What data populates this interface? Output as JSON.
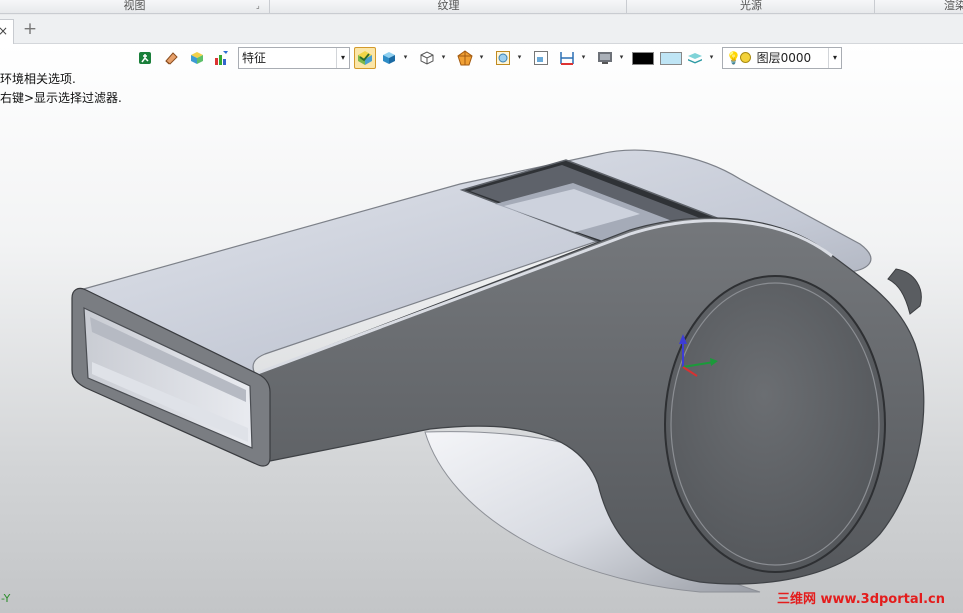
{
  "ribbon": {
    "groups": [
      {
        "label": "视图"
      },
      {
        "label": "纹理"
      },
      {
        "label": "光源"
      },
      {
        "label": "渲染"
      }
    ]
  },
  "tabs": {
    "close_glyph": "×",
    "add_glyph": "+"
  },
  "toolbar": {
    "icons": [
      {
        "name": "exit-icon",
        "color": "#1a7f3a"
      },
      {
        "name": "eraser-icon",
        "color": "#d98b4f"
      },
      {
        "name": "box-colored-icon",
        "color": "#4aa7d8"
      },
      {
        "name": "filter-color-icon",
        "color": "#3fa34d"
      }
    ],
    "filter_combo": {
      "value": "特征",
      "drop": "▾"
    },
    "dropdown_glyph": "▾",
    "color_swatches": [
      {
        "name": "black-swatch",
        "color": "#000000"
      },
      {
        "name": "light-blue-swatch",
        "color": "#bfe5f5"
      }
    ],
    "layer_combo": {
      "value": "图层0000",
      "drop": "▾"
    }
  },
  "hints": {
    "line1": "环境相关选项.",
    "line2": "右键>显示选择过滤器."
  },
  "triad": {
    "y_label": "-Y"
  },
  "watermark": "三维网 www.3dportal.cn"
}
